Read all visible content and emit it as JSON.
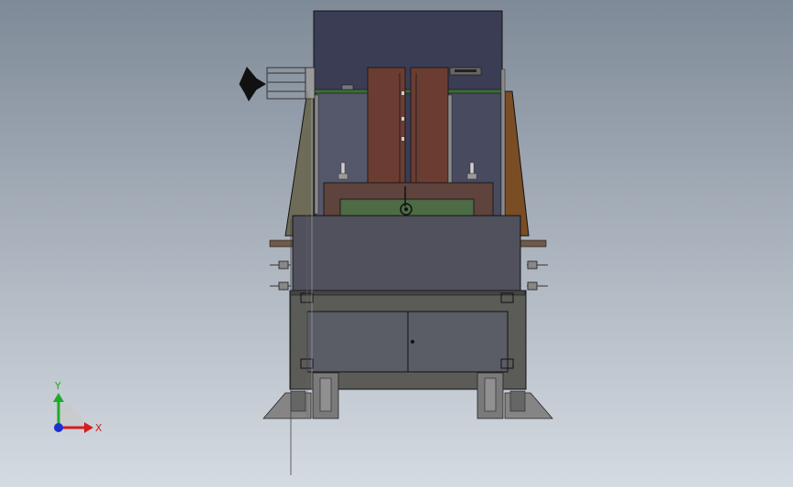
{
  "viewport": {
    "background_top": "#7f8a98",
    "background_bottom": "#d5dbe2"
  },
  "triad": {
    "y_label": "Y",
    "x_label": "X",
    "y_color": "#1faa2c",
    "x_color": "#d21f1f",
    "z_color": "#1f2fd2"
  },
  "colors": {
    "upper_panel": "#3b3d55",
    "cabinet": "#50515c",
    "frame": "#5b5b57",
    "door": "#5a5d66",
    "brown_post": "#6b3d32",
    "green_plate": "#4d6b45",
    "side_gusset_left": "#6e6c58",
    "side_gusset_right": "#7a4d25",
    "shelf": "#6e5a48",
    "edge": "#111111"
  }
}
